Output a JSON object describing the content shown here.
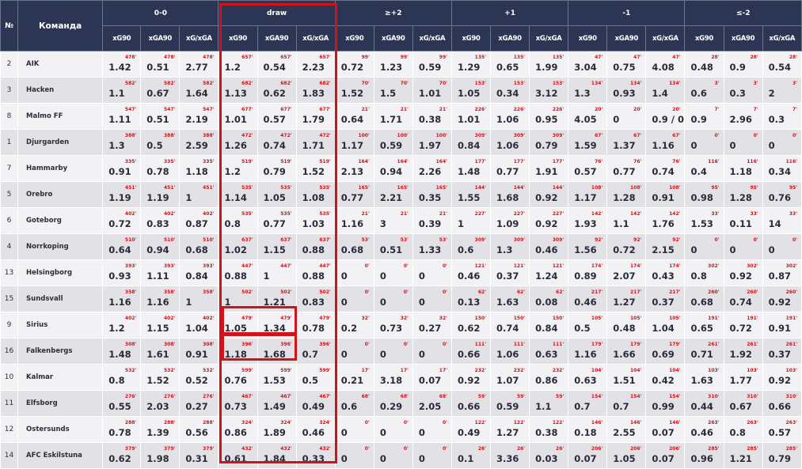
{
  "header": {
    "num_label": "№",
    "team_label": "Команда",
    "groups": [
      "0-0",
      "draw",
      "≥+2",
      "+1",
      "-1",
      "≤-2"
    ],
    "sub_labels": [
      "xG90",
      "xGA90",
      "xG/xGA"
    ]
  },
  "accent_color": "#d31119",
  "rows": [
    {
      "num": "2",
      "team": "AIK",
      "groups": [
        {
          "min": "478'",
          "v": [
            "1.42",
            "0.51",
            "2.77"
          ]
        },
        {
          "min": "657'",
          "v": [
            "1.2",
            "0.54",
            "2.23"
          ]
        },
        {
          "min": "99'",
          "v": [
            "0.72",
            "1.23",
            "0.59"
          ]
        },
        {
          "min": "135'",
          "v": [
            "1.29",
            "0.65",
            "1.99"
          ]
        },
        {
          "min": "47'",
          "v": [
            "3.04",
            "0.75",
            "4.08"
          ]
        },
        {
          "min": "28'",
          "v": [
            "0.48",
            "0.9",
            "0.54"
          ]
        }
      ]
    },
    {
      "num": "3",
      "team": "Hacken",
      "groups": [
        {
          "min": "582'",
          "v": [
            "1.1",
            "0.67",
            "1.64"
          ]
        },
        {
          "min": "682'",
          "v": [
            "1.13",
            "0.62",
            "1.83"
          ]
        },
        {
          "min": "70'",
          "v": [
            "1.52",
            "1.5",
            "1.01"
          ]
        },
        {
          "min": "153'",
          "v": [
            "1.05",
            "0.34",
            "3.12"
          ]
        },
        {
          "min": "134'",
          "v": [
            "1.3",
            "0.93",
            "1.4"
          ]
        },
        {
          "min": "3'",
          "v": [
            "0.6",
            "0.3",
            "2"
          ]
        }
      ]
    },
    {
      "num": "8",
      "team": "Malmo FF",
      "groups": [
        {
          "min": "547'",
          "v": [
            "1.11",
            "0.51",
            "2.19"
          ]
        },
        {
          "min": "677'",
          "v": [
            "1.01",
            "0.57",
            "1.79"
          ]
        },
        {
          "min": "21'",
          "v": [
            "0.64",
            "1.71",
            "0.38"
          ]
        },
        {
          "min": "226'",
          "v": [
            "1.01",
            "1.06",
            "0.95"
          ]
        },
        {
          "min": "20'",
          "v": [
            "4.05",
            "0",
            "0.9 / 0"
          ]
        },
        {
          "min": "7'",
          "v": [
            "0.9",
            "2.96",
            "0.3"
          ]
        }
      ]
    },
    {
      "num": "1",
      "team": "Djurgarden",
      "groups": [
        {
          "min": "388'",
          "v": [
            "1.3",
            "0.5",
            "2.59"
          ]
        },
        {
          "min": "472'",
          "v": [
            "1.26",
            "0.74",
            "1.71"
          ]
        },
        {
          "min": "100'",
          "v": [
            "1.17",
            "0.59",
            "1.97"
          ]
        },
        {
          "min": "309'",
          "v": [
            "0.84",
            "1.06",
            "0.79"
          ]
        },
        {
          "min": "67'",
          "v": [
            "1.59",
            "1.37",
            "1.16"
          ]
        },
        {
          "min": "0'",
          "v": [
            "0",
            "0",
            "0"
          ]
        }
      ]
    },
    {
      "num": "7",
      "team": "Hammarby",
      "groups": [
        {
          "min": "335'",
          "v": [
            "0.91",
            "0.78",
            "1.18"
          ]
        },
        {
          "min": "519'",
          "v": [
            "1.2",
            "0.79",
            "1.52"
          ]
        },
        {
          "min": "164'",
          "v": [
            "2.13",
            "0.94",
            "2.26"
          ]
        },
        {
          "min": "177'",
          "v": [
            "1.48",
            "0.77",
            "1.91"
          ]
        },
        {
          "min": "76'",
          "v": [
            "0.57",
            "0.77",
            "0.74"
          ]
        },
        {
          "min": "116'",
          "v": [
            "0.4",
            "1.18",
            "0.34"
          ]
        }
      ]
    },
    {
      "num": "5",
      "team": "Orebro",
      "groups": [
        {
          "min": "451'",
          "v": [
            "1.19",
            "1.19",
            "1"
          ]
        },
        {
          "min": "535'",
          "v": [
            "1.14",
            "1.05",
            "1.08"
          ]
        },
        {
          "min": "165'",
          "v": [
            "0.77",
            "2.21",
            "0.35"
          ]
        },
        {
          "min": "144'",
          "v": [
            "1.55",
            "1.68",
            "0.92"
          ]
        },
        {
          "min": "108'",
          "v": [
            "1.17",
            "1.28",
            "0.91"
          ]
        },
        {
          "min": "95'",
          "v": [
            "0.98",
            "1.28",
            "0.76"
          ]
        }
      ]
    },
    {
      "num": "6",
      "team": "Goteborg",
      "groups": [
        {
          "min": "402'",
          "v": [
            "0.72",
            "0.83",
            "0.87"
          ]
        },
        {
          "min": "535'",
          "v": [
            "0.8",
            "0.77",
            "1.03"
          ]
        },
        {
          "min": "21'",
          "v": [
            "1.16",
            "3",
            "0.39"
          ]
        },
        {
          "min": "227'",
          "v": [
            "1",
            "1.09",
            "0.92"
          ]
        },
        {
          "min": "142'",
          "v": [
            "1.93",
            "1.1",
            "1.76"
          ]
        },
        {
          "min": "33'",
          "v": [
            "1.53",
            "0.11",
            "14"
          ]
        }
      ]
    },
    {
      "num": "4",
      "team": "Norrkoping",
      "groups": [
        {
          "min": "510'",
          "v": [
            "0.64",
            "0.94",
            "0.68"
          ]
        },
        {
          "min": "637'",
          "v": [
            "1.02",
            "1.15",
            "0.88"
          ]
        },
        {
          "min": "53'",
          "v": [
            "0.68",
            "0.51",
            "1.33"
          ]
        },
        {
          "min": "309'",
          "v": [
            "0.6",
            "1.3",
            "0.46"
          ]
        },
        {
          "min": "92'",
          "v": [
            "1.56",
            "0.72",
            "2.15"
          ]
        },
        {
          "min": "0'",
          "v": [
            "0",
            "0",
            "0"
          ]
        }
      ]
    },
    {
      "num": "13",
      "team": "Helsingborg",
      "groups": [
        {
          "min": "393'",
          "v": [
            "0.93",
            "1.11",
            "0.84"
          ]
        },
        {
          "min": "447'",
          "v": [
            "0.88",
            "1",
            "0.88"
          ]
        },
        {
          "min": "0'",
          "v": [
            "0",
            "0",
            "0"
          ]
        },
        {
          "min": "121'",
          "v": [
            "0.46",
            "0.37",
            "1.24"
          ]
        },
        {
          "min": "174'",
          "v": [
            "0.89",
            "2.07",
            "0.43"
          ]
        },
        {
          "min": "302'",
          "v": [
            "0.8",
            "0.92",
            "0.87"
          ]
        }
      ]
    },
    {
      "num": "15",
      "team": "Sundsvall",
      "groups": [
        {
          "min": "358'",
          "v": [
            "1.16",
            "1.16",
            "1"
          ]
        },
        {
          "min": "502'",
          "v": [
            "1",
            "1.21",
            "0.83"
          ]
        },
        {
          "min": "0'",
          "v": [
            "0",
            "0",
            "0"
          ]
        },
        {
          "min": "62'",
          "v": [
            "0.13",
            "1.63",
            "0.08"
          ]
        },
        {
          "min": "217'",
          "v": [
            "0.46",
            "1.27",
            "0.37"
          ]
        },
        {
          "min": "260'",
          "v": [
            "0.68",
            "0.74",
            "0.92"
          ]
        }
      ]
    },
    {
      "num": "9",
      "team": "Sirius",
      "groups": [
        {
          "min": "402'",
          "v": [
            "1.2",
            "1.15",
            "1.04"
          ]
        },
        {
          "min": "479'",
          "v": [
            "1.05",
            "1.34",
            "0.78"
          ]
        },
        {
          "min": "32'",
          "v": [
            "0.2",
            "0.73",
            "0.27"
          ]
        },
        {
          "min": "150'",
          "v": [
            "0.62",
            "0.74",
            "0.84"
          ]
        },
        {
          "min": "105'",
          "v": [
            "0.5",
            "0.48",
            "1.04"
          ]
        },
        {
          "min": "191'",
          "v": [
            "0.65",
            "0.72",
            "0.91"
          ]
        }
      ]
    },
    {
      "num": "16",
      "team": "Falkenbergs",
      "groups": [
        {
          "min": "308'",
          "v": [
            "1.48",
            "1.61",
            "0.91"
          ]
        },
        {
          "min": "396'",
          "v": [
            "1.18",
            "1.68",
            "0.7"
          ]
        },
        {
          "min": "0'",
          "v": [
            "0",
            "0",
            "0"
          ]
        },
        {
          "min": "111'",
          "v": [
            "0.66",
            "1.06",
            "0.63"
          ]
        },
        {
          "min": "179'",
          "v": [
            "1.16",
            "1.66",
            "0.69"
          ]
        },
        {
          "min": "261'",
          "v": [
            "0.71",
            "1.92",
            "0.37"
          ]
        }
      ]
    },
    {
      "num": "10",
      "team": "Kalmar",
      "groups": [
        {
          "min": "532'",
          "v": [
            "0.8",
            "1.52",
            "0.52"
          ]
        },
        {
          "min": "599'",
          "v": [
            "0.76",
            "1.53",
            "0.5"
          ]
        },
        {
          "min": "17'",
          "v": [
            "0.21",
            "3.18",
            "0.07"
          ]
        },
        {
          "min": "232'",
          "v": [
            "0.92",
            "1.07",
            "0.86"
          ]
        },
        {
          "min": "104'",
          "v": [
            "0.63",
            "1.51",
            "0.42"
          ]
        },
        {
          "min": "103'",
          "v": [
            "1.63",
            "1.77",
            "0.92"
          ]
        }
      ]
    },
    {
      "num": "11",
      "team": "Elfsborg",
      "groups": [
        {
          "min": "276'",
          "v": [
            "0.55",
            "2.03",
            "0.27"
          ]
        },
        {
          "min": "467'",
          "v": [
            "0.73",
            "1.49",
            "0.49"
          ]
        },
        {
          "min": "68'",
          "v": [
            "0.6",
            "0.29",
            "2.05"
          ]
        },
        {
          "min": "59'",
          "v": [
            "0.66",
            "0.59",
            "1.1"
          ]
        },
        {
          "min": "154'",
          "v": [
            "0.7",
            "0.7",
            "0.99"
          ]
        },
        {
          "min": "310'",
          "v": [
            "0.44",
            "0.67",
            "0.66"
          ]
        }
      ]
    },
    {
      "num": "12",
      "team": "Ostersunds",
      "groups": [
        {
          "min": "288'",
          "v": [
            "0.78",
            "1.39",
            "0.56"
          ]
        },
        {
          "min": "324'",
          "v": [
            "0.86",
            "1.89",
            "0.46"
          ]
        },
        {
          "min": "0'",
          "v": [
            "0",
            "0",
            "0"
          ]
        },
        {
          "min": "122'",
          "v": [
            "0.49",
            "1.27",
            "0.38"
          ]
        },
        {
          "min": "146'",
          "v": [
            "0.18",
            "2.55",
            "0.07"
          ]
        },
        {
          "min": "263'",
          "v": [
            "0.46",
            "0.8",
            "0.57"
          ]
        }
      ]
    },
    {
      "num": "14",
      "team": "AFC Eskilstuna",
      "groups": [
        {
          "min": "379'",
          "v": [
            "0.62",
            "1.98",
            "0.31"
          ]
        },
        {
          "min": "432'",
          "v": [
            "0.61",
            "1.84",
            "0.33"
          ]
        },
        {
          "min": "0'",
          "v": [
            "0",
            "0",
            "0"
          ]
        },
        {
          "min": "26'",
          "v": [
            "0.1",
            "3.36",
            "0.03"
          ]
        },
        {
          "min": "206'",
          "v": [
            "0.07",
            "1.05",
            "0.07"
          ]
        },
        {
          "min": "285'",
          "v": [
            "0.96",
            "1.21",
            "0.79"
          ]
        }
      ]
    }
  ]
}
